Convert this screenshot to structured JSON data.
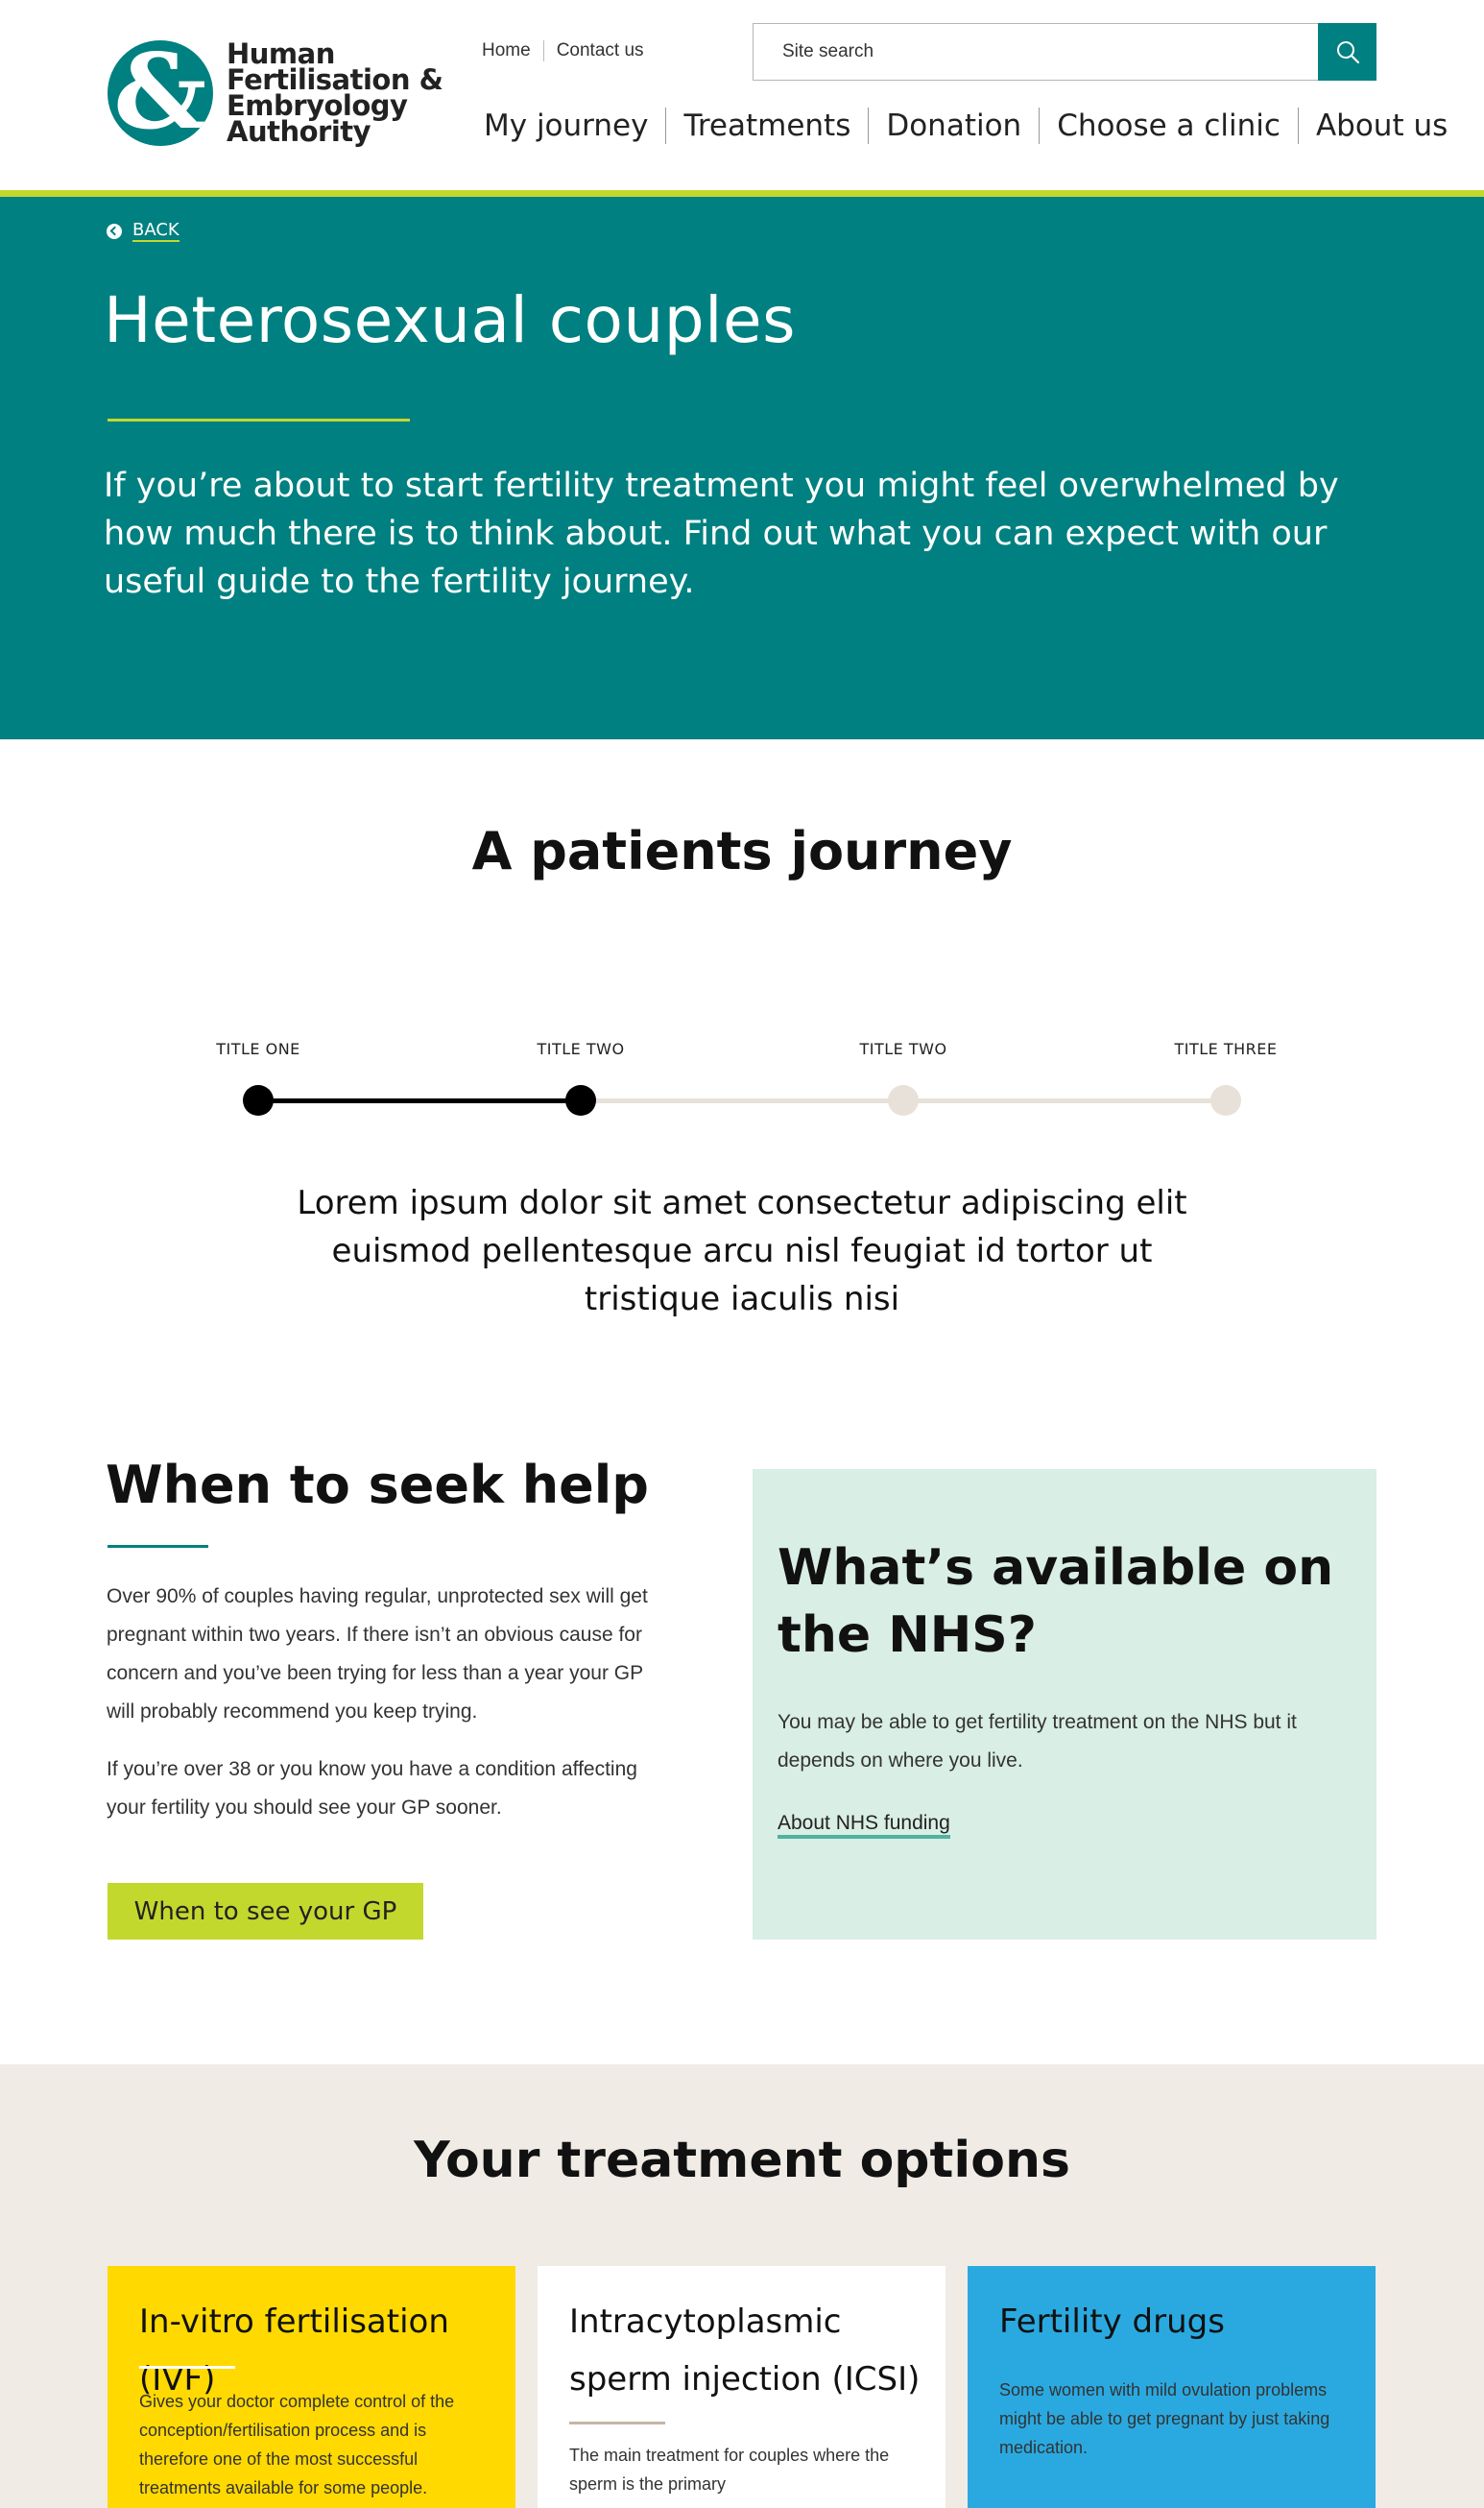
{
  "header": {
    "logo": {
      "lines": [
        "Human",
        "Fertilisation &",
        "Embryology",
        "Authority"
      ]
    },
    "utility_links": [
      "Home",
      "Contact us"
    ],
    "search": {
      "placeholder": "Site search"
    },
    "nav": [
      "My journey",
      "Treatments",
      "Donation",
      "Choose a clinic",
      "About us"
    ]
  },
  "hero": {
    "back_label": "BACK",
    "title": "Heterosexual couples",
    "intro": "If you’re about to start fertility treatment you might feel overwhelmed by how much there is to think about. Find out what you can expect with our useful guide to the fertility journey."
  },
  "journey": {
    "title": "A patients journey",
    "steps": [
      {
        "label": "TITLE ONE",
        "completed": true
      },
      {
        "label": "TITLE TWO",
        "completed": true
      },
      {
        "label": "TITLE TWO",
        "completed": false
      },
      {
        "label": "TITLE THREE",
        "completed": false
      }
    ],
    "text": "Lorem ipsum dolor sit amet consectetur adipiscing elit euismod pellentesque arcu nisl feugiat id tortor ut tristique iaculis nisi"
  },
  "seek_help": {
    "title": "When to seek help",
    "paragraphs": [
      "Over 90% of couples having regular, unprotected sex will get pregnant within two years. If there isn’t an obvious cause for concern and you’ve been trying for less than a year your GP will probably recommend you keep trying.",
      "If you’re over 38 or you know you have a condition affecting your fertility you should see your GP sooner."
    ],
    "button_label": "When to see your GP"
  },
  "nhs": {
    "title": "What’s available on the NHS?",
    "text": "You may be able to get fertility treatment on the NHS but it depends on where you live.",
    "link_label": "About NHS funding"
  },
  "treatments": {
    "title": "Your treatment options",
    "cards": [
      {
        "title": "In-vitro fertilisation (IVF)",
        "text": "Gives your doctor complete control of the conception/fertilisation process and is therefore one of the most successful treatments available for some people.",
        "bg": "#ffd900",
        "rule": "#ffffff"
      },
      {
        "title": "Intracytoplasmic sperm injection (ICSI)",
        "text": "The main treatment for couples where the sperm is the primary",
        "bg": "#ffffff",
        "rule": "#c6b5a6"
      },
      {
        "title": "Fertility drugs",
        "text": "Some women with mild ovulation problems might be able to get pregnant by just taking medication.",
        "bg": "#2aa9e0",
        "rule": ""
      }
    ]
  },
  "colors": {
    "teal": "#008080",
    "lime": "#c3d82d",
    "mint": "#d9eee5",
    "beige": "#f0ebe5",
    "journey_done": "#000000",
    "journey_todo": "#e8e1da"
  },
  "icons": {
    "search": "search-icon",
    "back": "chevron-left-circle-icon"
  }
}
